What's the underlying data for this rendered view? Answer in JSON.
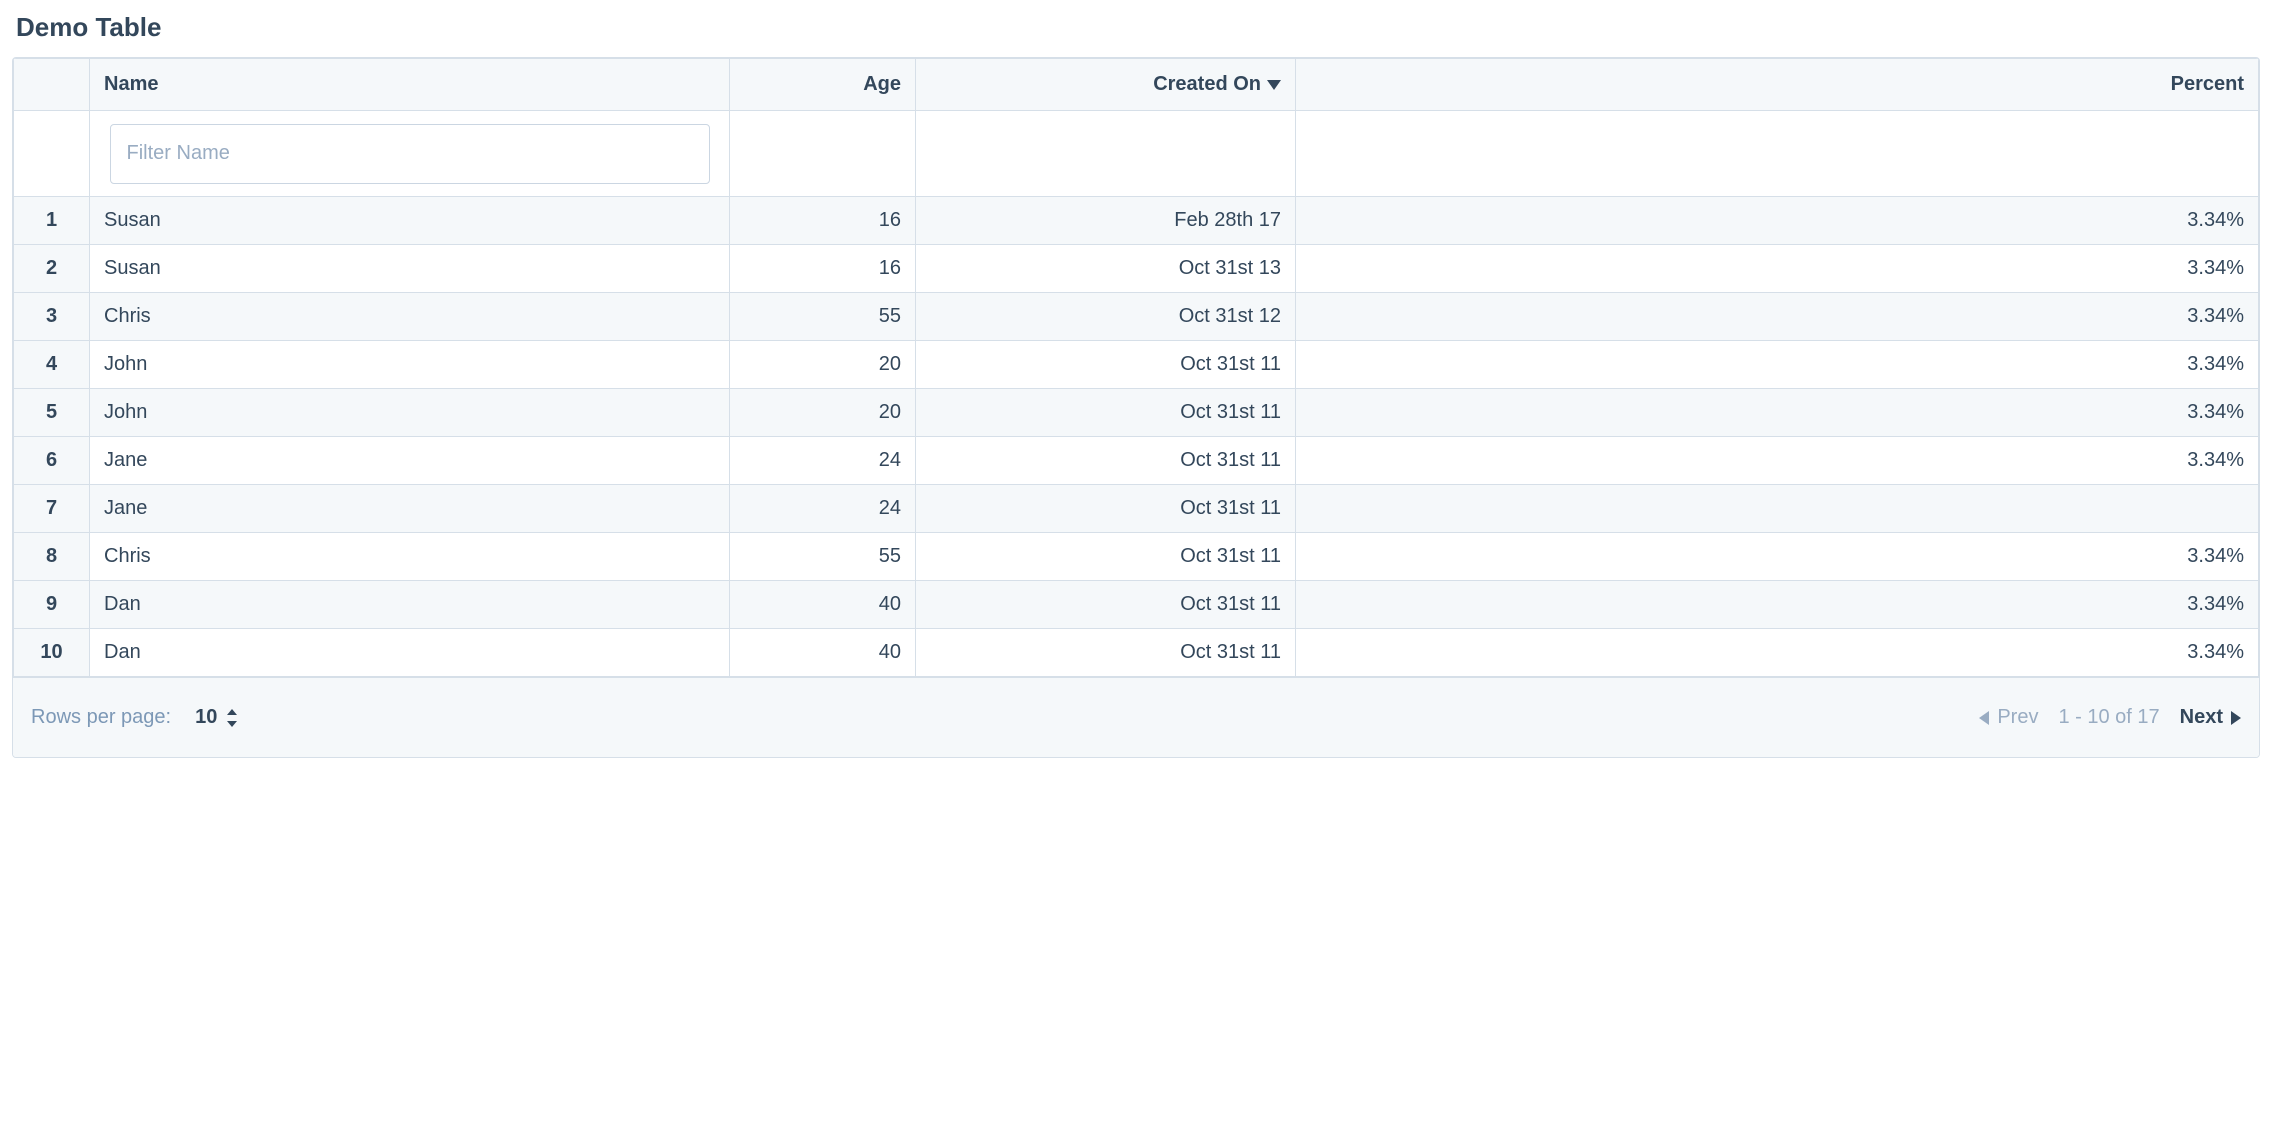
{
  "title": "Demo Table",
  "columns": {
    "name": "Name",
    "age": "Age",
    "created": "Created On",
    "percent": "Percent"
  },
  "sorted_column": "created",
  "sort_direction": "desc",
  "filter": {
    "name_placeholder": "Filter Name",
    "name_value": ""
  },
  "rows": [
    {
      "n": "1",
      "name": "Susan",
      "age": "16",
      "created": "Feb 28th 17",
      "percent": "3.34%"
    },
    {
      "n": "2",
      "name": "Susan",
      "age": "16",
      "created": "Oct 31st 13",
      "percent": "3.34%"
    },
    {
      "n": "3",
      "name": "Chris",
      "age": "55",
      "created": "Oct 31st 12",
      "percent": "3.34%"
    },
    {
      "n": "4",
      "name": "John",
      "age": "20",
      "created": "Oct 31st 11",
      "percent": "3.34%"
    },
    {
      "n": "5",
      "name": "John",
      "age": "20",
      "created": "Oct 31st 11",
      "percent": "3.34%"
    },
    {
      "n": "6",
      "name": "Jane",
      "age": "24",
      "created": "Oct 31st 11",
      "percent": "3.34%"
    },
    {
      "n": "7",
      "name": "Jane",
      "age": "24",
      "created": "Oct 31st 11",
      "percent": ""
    },
    {
      "n": "8",
      "name": "Chris",
      "age": "55",
      "created": "Oct 31st 11",
      "percent": "3.34%"
    },
    {
      "n": "9",
      "name": "Dan",
      "age": "40",
      "created": "Oct 31st 11",
      "percent": "3.34%"
    },
    {
      "n": "10",
      "name": "Dan",
      "age": "40",
      "created": "Oct 31st 11",
      "percent": "3.34%"
    }
  ],
  "footer": {
    "rows_per_page_label": "Rows per page:",
    "rows_per_page_value": "10",
    "prev_label": "Prev",
    "next_label": "Next",
    "range_text": "1 - 10 of 17"
  }
}
